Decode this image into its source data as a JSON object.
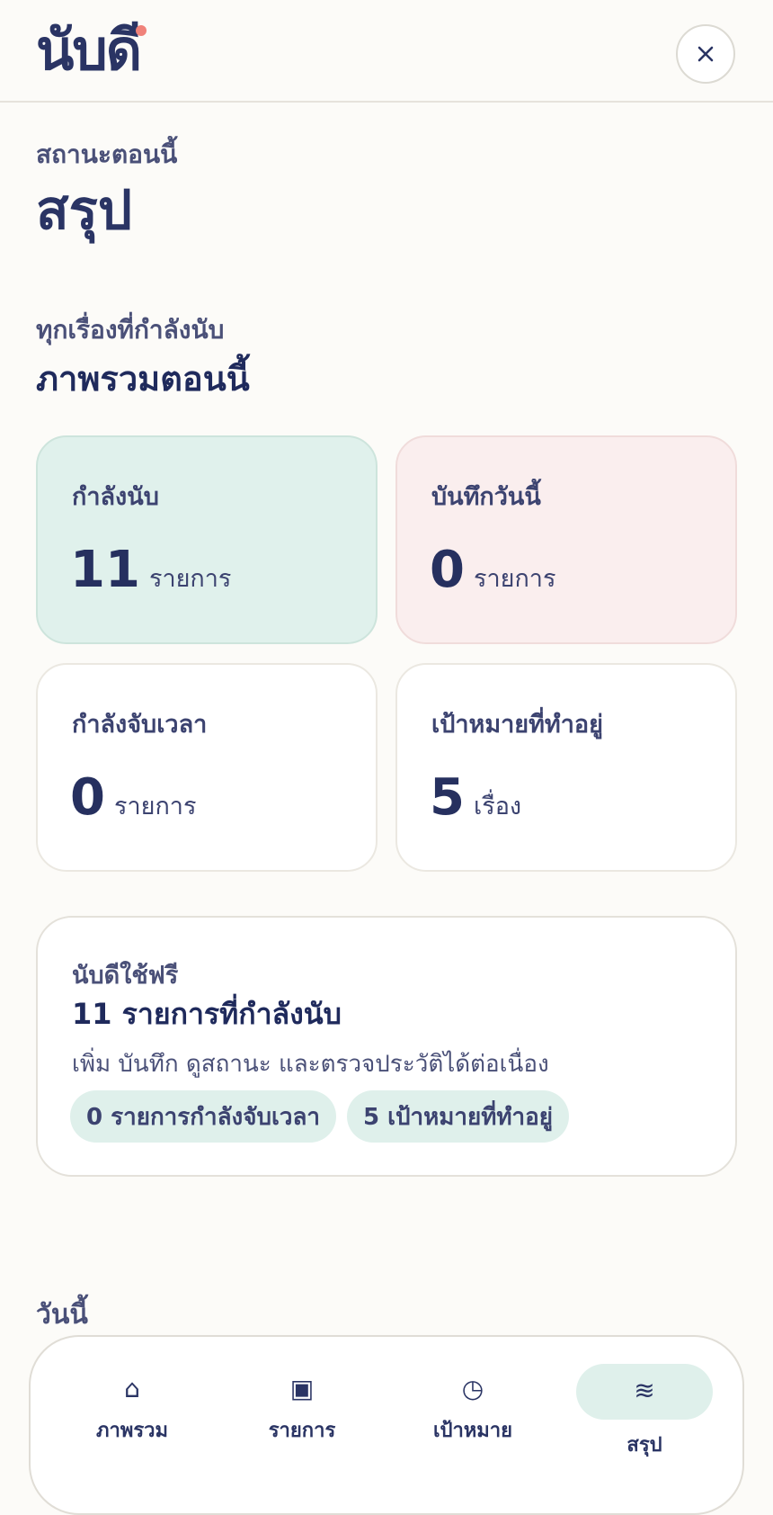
{
  "header": {
    "logo_text": "นับดี",
    "accent_color": "#f0827a",
    "close_icon": "close-icon"
  },
  "page": {
    "eyebrow": "สถานะตอนนี้",
    "title": "สรุป"
  },
  "overview": {
    "eyebrow": "ทุกเรื่องที่กำลังนับ",
    "title": "ภาพรวมตอนนี้"
  },
  "stats": [
    {
      "label": "กำลังนับ",
      "value": "11",
      "unit": "รายการ",
      "color": "#e0f1ec"
    },
    {
      "label": "บันทึกวันนี้",
      "value": "0",
      "unit": "รายการ",
      "color": "#faeeee"
    },
    {
      "label": "กำลังจับเวลา",
      "value": "0",
      "unit": "รายการ",
      "color": "#ffffff"
    },
    {
      "label": "เป้าหมายที่ทำอยู่",
      "value": "5",
      "unit": "เรื่อง",
      "color": "#ffffff"
    }
  ],
  "promo": {
    "label": "นับดีใช้ฟรี",
    "title": "11 รายการที่กำลังนับ",
    "description": "เพิ่ม บันทึก ดูสถานะ และตรวจประวัติได้ต่อเนื่อง",
    "chips": [
      "0 รายการกำลังจับเวลา",
      "5 เป้าหมายที่ทำอยู่"
    ]
  },
  "today": {
    "title": "วันนี้"
  },
  "nav": {
    "items": [
      {
        "label": "ภาพรวม",
        "icon": "home-icon",
        "glyph": "⌂"
      },
      {
        "label": "รายการ",
        "icon": "list-icon",
        "glyph": "▣"
      },
      {
        "label": "เป้าหมาย",
        "icon": "clock-icon",
        "glyph": "◷"
      },
      {
        "label": "สรุป",
        "icon": "summary-icon",
        "glyph": "≋",
        "active": true
      }
    ],
    "active_color": "#dff0eb"
  }
}
